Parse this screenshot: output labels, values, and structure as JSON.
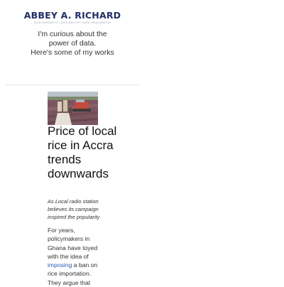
{
  "brand": {
    "name": "ABBEY A. RICHARD",
    "tagline": "DATA JOURNALIST | DATA ANALYST | DATA VISUALIZATION"
  },
  "intro": {
    "line1": "I'm curious about the",
    "line2": "power of data.",
    "line3": "Here's some of my works"
  },
  "article": {
    "image_alt": "Rice farm harvest photo",
    "title": "Price of local rice in Accra trends downwards",
    "subtitle": "As Local radio station believes its campaign inspired the popularity",
    "body_before_link": "For years, policymakers in Ghana have toyed with the idea of",
    "body_link": "imposing",
    "body_after_link": "a ban on rice importation. They argue that"
  },
  "colors": {
    "brand": "#232d66",
    "link": "#2a5ab0",
    "divider": "#e4e4e4"
  }
}
